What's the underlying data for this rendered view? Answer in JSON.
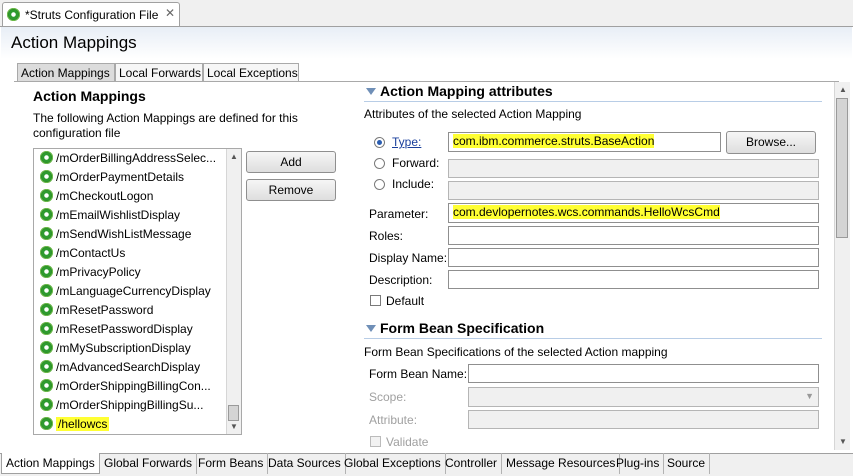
{
  "editor": {
    "tab_title": "*Struts Configuration File",
    "close_glyph": "✕"
  },
  "page": {
    "title": "Action Mappings"
  },
  "inner_tabs": [
    "Action Mappings",
    "Local Forwards",
    "Local Exceptions"
  ],
  "left": {
    "heading": "Action Mappings",
    "description": "The following Action Mappings are defined for this configuration file",
    "items": [
      "/mOrderBillingAddressSelec...",
      "/mOrderPaymentDetails",
      "/mCheckoutLogon",
      "/mEmailWishlistDisplay",
      "/mSendWishListMessage",
      "/mContactUs",
      "/mPrivacyPolicy",
      "/mLanguageCurrencyDisplay",
      "/mResetPassword",
      "/mResetPasswordDisplay",
      "/mMySubscriptionDisplay",
      "/mAdvancedSearchDisplay",
      "/mOrderShippingBillingCon...",
      "/mOrderShippingBillingSu...",
      "/hellowcs"
    ],
    "selected_index": 14,
    "add_label": "Add",
    "remove_label": "Remove"
  },
  "attributes": {
    "heading": "Action Mapping attributes",
    "subtitle": "Attributes of the selected Action Mapping",
    "type_label": "Type:",
    "type_value": "com.ibm.commerce.struts.BaseAction",
    "browse_label": "Browse...",
    "forward_label": "Forward:",
    "include_label": "Include:",
    "parameter_label": "Parameter:",
    "parameter_value": "com.devlopernotes.wcs.commands.HelloWcsCmd",
    "roles_label": "Roles:",
    "display_name_label": "Display Name:",
    "description_label": "Description:",
    "default_label": "Default"
  },
  "form_bean": {
    "heading": "Form Bean Specification",
    "subtitle": "Form Bean Specifications of the selected Action mapping",
    "name_label": "Form Bean Name:",
    "scope_label": "Scope:",
    "attribute_label": "Attribute:",
    "validate_label": "Validate"
  },
  "bottom_tabs": [
    "Action Mappings",
    "Global Forwards",
    "Form Beans",
    "Data Sources",
    "Global Exceptions",
    "Controller",
    "Message Resources",
    "Plug-ins",
    "Source"
  ],
  "colors": {
    "highlight": "#ffff33",
    "section_rule": "#b8cde6",
    "triangle": "#6f8fb7"
  },
  "icons": {
    "mapping": "gear-icon",
    "close": "close-icon"
  }
}
